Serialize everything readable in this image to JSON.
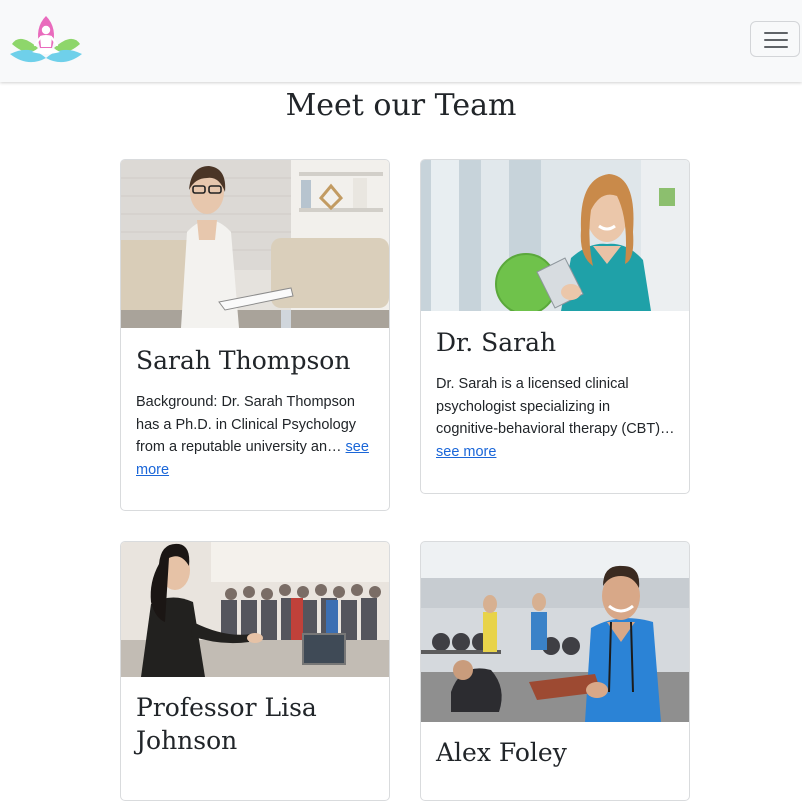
{
  "navbar": {
    "logo": "lotus-meditation-logo",
    "toggler": "hamburger-menu-icon"
  },
  "page": {
    "heading": "Meet our Team"
  },
  "team": [
    {
      "name": "Sarah Thompson",
      "text": "Background: Dr. Sarah Thompson has a Ph.D. in Clinical Psychology from a reputable university an…",
      "link": "see more",
      "image": "therapist-office-photo"
    },
    {
      "name": "Dr. Sarah",
      "text": "Dr. Sarah is a licensed clinical psychologist specializing in cognitive-behavioral therapy (CBT)…",
      "link": "see more",
      "image": "clinic-doctor-photo"
    },
    {
      "name": "Professor Lisa Johnson",
      "text": "",
      "link": "",
      "image": "lecture-audience-photo"
    },
    {
      "name": "Alex Foley",
      "text": "",
      "link": "",
      "image": "gym-trainer-photo"
    }
  ],
  "colors": {
    "navbar_bg": "#f8f9fa",
    "link": "#1a66d8",
    "logo_pink": "#e96bbd",
    "logo_green": "#8ed66b",
    "logo_blue": "#6fd0ea"
  }
}
